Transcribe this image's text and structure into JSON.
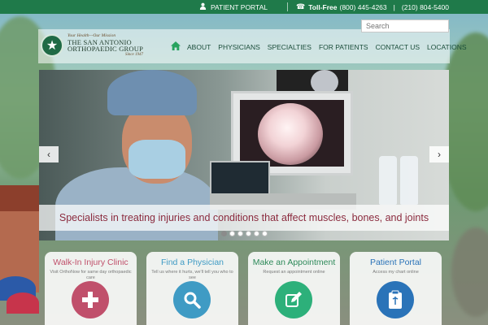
{
  "topbar": {
    "portal_label": "PATIENT PORTAL",
    "tollfree_label": "Toll-Free",
    "tollfree_number": "(800) 445-4263",
    "phone_number": "(210) 804-5400"
  },
  "search": {
    "placeholder": "Search"
  },
  "logo": {
    "tagline": "Your Health—Our Mission",
    "name_line1": "THE SAN ANTONIO",
    "name_line2": "ORTHOPAEDIC GROUP",
    "since": "Since 1947"
  },
  "nav": {
    "items": [
      "ABOUT",
      "PHYSICIANS",
      "SPECIALTIES",
      "FOR PATIENTS",
      "CONTACT US",
      "LOCATIONS"
    ]
  },
  "hero": {
    "caption": "Specialists in treating injuries and conditions that affect muscles, bones, and joints",
    "prev_arrow": "‹",
    "next_arrow": "›",
    "slide_count": 6,
    "active_slide": 1
  },
  "cards": [
    {
      "title": "Walk-In Injury Clinic",
      "subtitle": "Visit OrthoNow for same day orthopaedic care",
      "icon": "plus-icon",
      "color": "#c0506b",
      "title_color": "#c0506b"
    },
    {
      "title": "Find a Physician",
      "subtitle": "Tell us where it hurts, we'll tell you who to see",
      "icon": "search-icon",
      "color": "#3f9bc4",
      "title_color": "#3f9bc4"
    },
    {
      "title": "Make an Appointment",
      "subtitle": "Request an appointment online",
      "icon": "edit-icon",
      "color": "#2db07a",
      "title_color": "#2e8a5a"
    },
    {
      "title": "Patient Portal",
      "subtitle": "Access my chart online",
      "icon": "clipboard-icon",
      "color": "#2a73b8",
      "title_color": "#2a73b8"
    }
  ],
  "colors": {
    "topbar": "#1f7a4a",
    "caption_text": "#8b2b3e"
  }
}
